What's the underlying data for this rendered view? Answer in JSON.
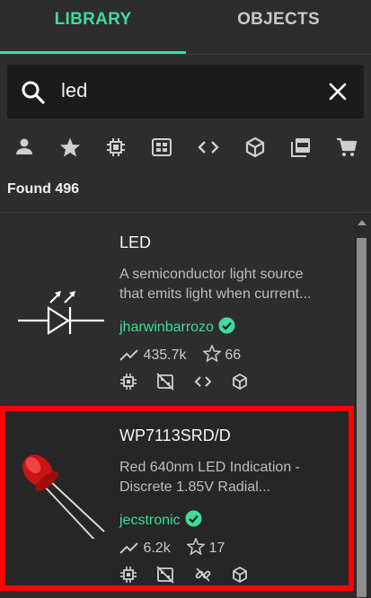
{
  "tabs": [
    {
      "label": "LIBRARY",
      "active": true
    },
    {
      "label": "OBJECTS",
      "active": false
    }
  ],
  "search": {
    "value": "led",
    "placeholder": ""
  },
  "filters": [
    "person-icon",
    "star-icon",
    "chip-icon",
    "module-icon",
    "code-icon",
    "cube-icon",
    "pdf-icon",
    "cart-icon"
  ],
  "results": {
    "found_text": "Found 496"
  },
  "cards": [
    {
      "title": "LED",
      "desc_lines": [
        "A semiconductor light source",
        "that emits light when current..."
      ],
      "author": "jharwinbarrozo",
      "verified": true,
      "views": "435.7k",
      "stars": "66",
      "type_icons": [
        "chip-icon",
        "no-footprint-icon",
        "code-icon",
        "cube-icon"
      ],
      "selected": false
    },
    {
      "title": "WP7113SRD/D",
      "desc_lines": [
        "Red 640nm LED Indication -",
        "Discrete 1.85V Radial..."
      ],
      "author": "jecstronic",
      "verified": true,
      "views": "6.2k",
      "stars": "17",
      "type_icons": [
        "chip-icon",
        "no-footprint-icon",
        "no-link-icon",
        "cube-icon"
      ],
      "selected": true
    }
  ],
  "colors": {
    "accent": "#3fdc9c",
    "background": "#2d2d2d",
    "search_bg": "#1b1b1b",
    "highlight": "#ff0000"
  }
}
